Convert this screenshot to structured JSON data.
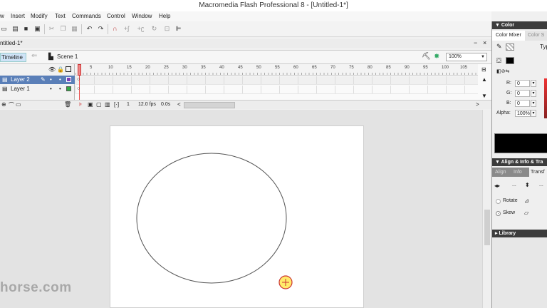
{
  "window": {
    "title": "Macromedia Flash Professional 8 - [Untitled-1*]"
  },
  "menu": [
    "w",
    "Insert",
    "Modify",
    "Text",
    "Commands",
    "Control",
    "Window",
    "Help"
  ],
  "toolbar_icons": [
    "new-icon",
    "open-icon",
    "save-icon",
    "print-icon",
    "cut-icon",
    "copy-icon",
    "paste-icon",
    "undo-icon",
    "redo-icon",
    "snap-icon",
    "smooth-icon",
    "straighten-icon",
    "rotate-icon",
    "scale-icon",
    "align-icon"
  ],
  "document": {
    "tab": "ntitled-1*"
  },
  "scene": {
    "timeline_tab": "Timeline",
    "scene_label": "Scene 1",
    "zoom": "100%"
  },
  "timeline": {
    "layers": [
      {
        "name": "Layer 2",
        "selected": true,
        "color": "#7a3fb8"
      },
      {
        "name": "Layer 1",
        "selected": false,
        "color": "#33aa44"
      }
    ],
    "ruler": [
      "5",
      "10",
      "15",
      "20",
      "25",
      "30",
      "35",
      "40",
      "45",
      "50",
      "55",
      "60",
      "65",
      "70",
      "75",
      "80",
      "85",
      "90",
      "95",
      "100",
      "105"
    ],
    "frame": "1",
    "fps": "12.0 fps",
    "time": "0.0s"
  },
  "panels": {
    "color": {
      "title": "Color",
      "tabs": [
        "Color Mixer",
        "Color S"
      ],
      "type_label": "Typ",
      "r_label": "R:",
      "r_value": "0",
      "g_label": "G:",
      "g_value": "0",
      "b_label": "B:",
      "b_value": "0",
      "alpha_label": "Alpha:",
      "alpha_value": "100%"
    },
    "align": {
      "title": "Align & Info & Tra",
      "tabs": [
        "Align",
        "Info",
        "Transf"
      ],
      "width_value": "...",
      "height_value": "...",
      "rotate_label": "Rotate",
      "skew_label": "Skew"
    },
    "library": {
      "title": "Library"
    }
  },
  "watermark": "horse.com",
  "colors": {
    "accent": "#3a6fd8",
    "timeline_tab": "#cfe3f7",
    "playhead": "#e85050",
    "dark_panel": "#3c3c3c"
  }
}
